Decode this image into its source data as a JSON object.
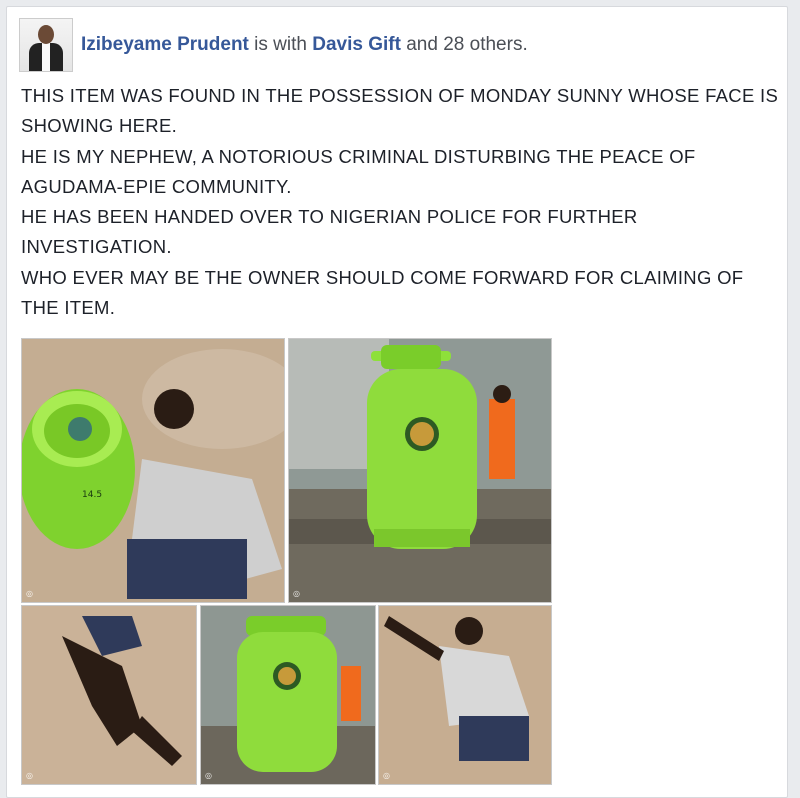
{
  "post": {
    "author": "Izibeyame Prudent",
    "with_text": "is with",
    "tagged": "Davis Gift",
    "and_text": "and",
    "others": "28 others.",
    "paragraphs": [
      "THIS ITEM WAS FOUND IN THE POSSESSION OF MONDAY  SUNNY WHOSE FACE IS SHOWING HERE.",
      "HE IS MY NEPHEW, A NOTORIOUS CRIMINAL DISTURBING THE PEACE OF AGUDAMA-EPIE  COMMUNITY.",
      "HE HAS BEEN HANDED OVER TO NIGERIAN POLICE FOR FURTHER INVESTIGATION.",
      "WHO EVER MAY BE THE OWNER SHOULD COME FORWARD FOR CLAIMING OF THE ITEM."
    ],
    "cylinder_label": "14.5",
    "photos": [
      {
        "name": "man-with-gas-cylinder-photo"
      },
      {
        "name": "gas-cylinder-on-bench-photo"
      },
      {
        "name": "man-lying-face-down-photo"
      },
      {
        "name": "gas-cylinder-closeup-photo"
      },
      {
        "name": "man-lying-arms-spread-photo"
      }
    ],
    "colors": {
      "link": "#365899",
      "text": "#1d2129",
      "cylinder": "#8fdc3c"
    }
  }
}
